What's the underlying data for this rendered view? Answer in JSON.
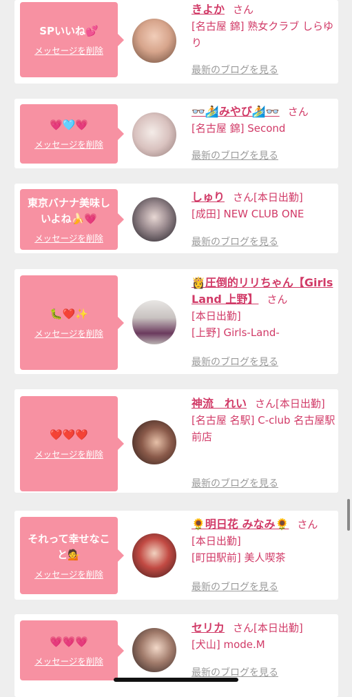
{
  "delete_label": "メッセージを削除",
  "blog_label": "最新のブログを見る",
  "san_label": "さん",
  "colors": {
    "accent_pink": "#f791a2",
    "text_pink": "#d13a67",
    "link_gray": "#9a9a9a",
    "background": "#eeeeee"
  },
  "messages": [
    {
      "message": "SPいいね💕",
      "name": "きよか",
      "suffix": "",
      "details": [
        "[名古屋 錦] 熟女クラブ しらゆり"
      ],
      "avatar_icon": "avatar-photo"
    },
    {
      "message": "💗🩵💗",
      "name": "👓🏄みやび🏄👓",
      "suffix": "",
      "details": [
        "[名古屋 錦] Second"
      ],
      "avatar_icon": "avatar-photo"
    },
    {
      "message": "東京バナナ美味しいよね🍌💗",
      "name": "しゅり",
      "suffix": "[本日出勤]",
      "details": [
        "[成田] NEW CLUB ONE"
      ],
      "avatar_icon": "avatar-photo"
    },
    {
      "message": "🐛❤️✨",
      "name": "👸圧倒的リリちゃん【Girls Land 上野】",
      "suffix": "",
      "details": [
        "[本日出勤]",
        "[上野] Girls-Land-"
      ],
      "avatar_icon": "avatar-photo"
    },
    {
      "message": "❤️❤️❤️",
      "name": "神流　れい",
      "suffix": "[本日出勤]",
      "details": [
        "[名古屋 名駅] C-club 名古屋駅前店"
      ],
      "avatar_icon": "avatar-photo"
    },
    {
      "message": "それって幸せなこと💁",
      "name": "🌻明日花 みなみ🌻",
      "suffix": "",
      "details": [
        "[本日出勤]",
        "[町田駅前] 美人喫茶"
      ],
      "avatar_icon": "avatar-photo"
    },
    {
      "message": "💗💗💗",
      "name": "セリカ",
      "suffix": "[本日出勤]",
      "details": [
        "[犬山] mode.M"
      ],
      "avatar_icon": "avatar-photo"
    }
  ]
}
